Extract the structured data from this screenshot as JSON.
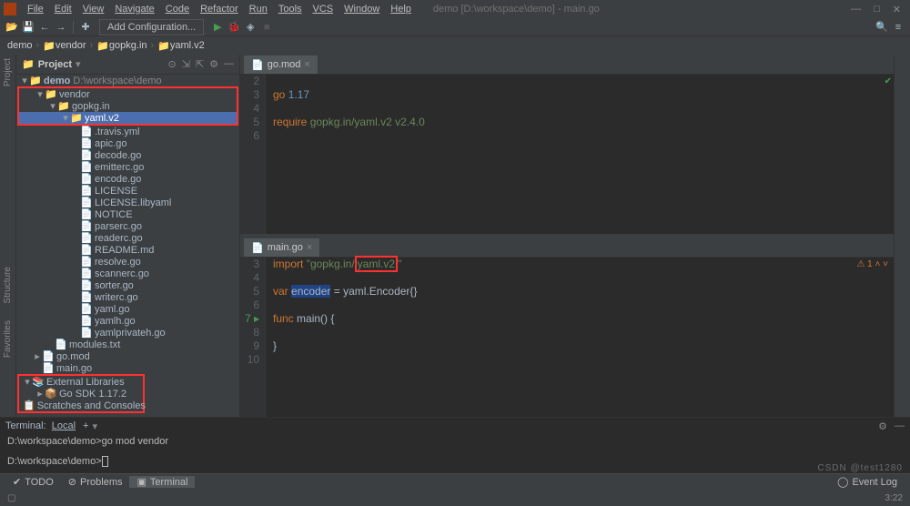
{
  "menu": [
    "File",
    "Edit",
    "View",
    "Navigate",
    "Code",
    "Refactor",
    "Run",
    "Tools",
    "VCS",
    "Window",
    "Help"
  ],
  "window_title": "demo [D:\\workspace\\demo] - main.go",
  "add_config": "Add Configuration...",
  "breadcrumb": [
    "demo",
    "vendor",
    "gopkg.in",
    "yaml.v2"
  ],
  "sidebar": {
    "title": "Project",
    "root": "demo",
    "root_path": "D:\\workspace\\demo",
    "vendor": "vendor",
    "gopkg": "gopkg.in",
    "yaml": "yaml.v2",
    "files": [
      ".travis.yml",
      "apic.go",
      "decode.go",
      "emitterc.go",
      "encode.go",
      "LICENSE",
      "LICENSE.libyaml",
      "NOTICE",
      "parserc.go",
      "readerc.go",
      "README.md",
      "resolve.go",
      "scannerc.go",
      "sorter.go",
      "writerc.go",
      "yaml.go",
      "yamlh.go",
      "yamlprivateh.go"
    ],
    "modules": "modules.txt",
    "gomod": "go.mod",
    "maingo": "main.go",
    "extlib": "External Libraries",
    "sdk": "Go SDK 1.17.2",
    "scratch": "Scratches and Consoles"
  },
  "tabs": {
    "top": "go.mod",
    "bottom": "main.go"
  },
  "gomod_lines": {
    "2": "",
    "3": "go 1.17",
    "4": "",
    "5": "require gopkg.in/yaml.v2 v2.4.0",
    "6": ""
  },
  "main_lines": {
    "l3": {
      "pre": "import ",
      "q1": "\"gopkg.in/",
      "boxed": "yaml.v2",
      "q2": "\""
    },
    "l5": {
      "kw": "var",
      "sp": " ",
      "var": "encoder",
      "rest": " = yaml.Encoder{}"
    },
    "l7": {
      "kw": "func",
      "rest": " main() {"
    },
    "l9": "}"
  },
  "warn": "⚠ 1",
  "terminal": {
    "tab": "Terminal",
    "local": "Local",
    "prompt1": "D:\\workspace\\demo>",
    "cmd1": "go mod vendor",
    "prompt2": "D:\\workspace\\demo>"
  },
  "bottom_tabs": {
    "todo": "TODO",
    "problems": "Problems",
    "terminal": "Terminal"
  },
  "status": {
    "event": "Event Log",
    "pos": "3:22",
    "watermark": "CSDN @test1280"
  },
  "gutters": [
    "Project",
    "Structure",
    "Favorites"
  ]
}
